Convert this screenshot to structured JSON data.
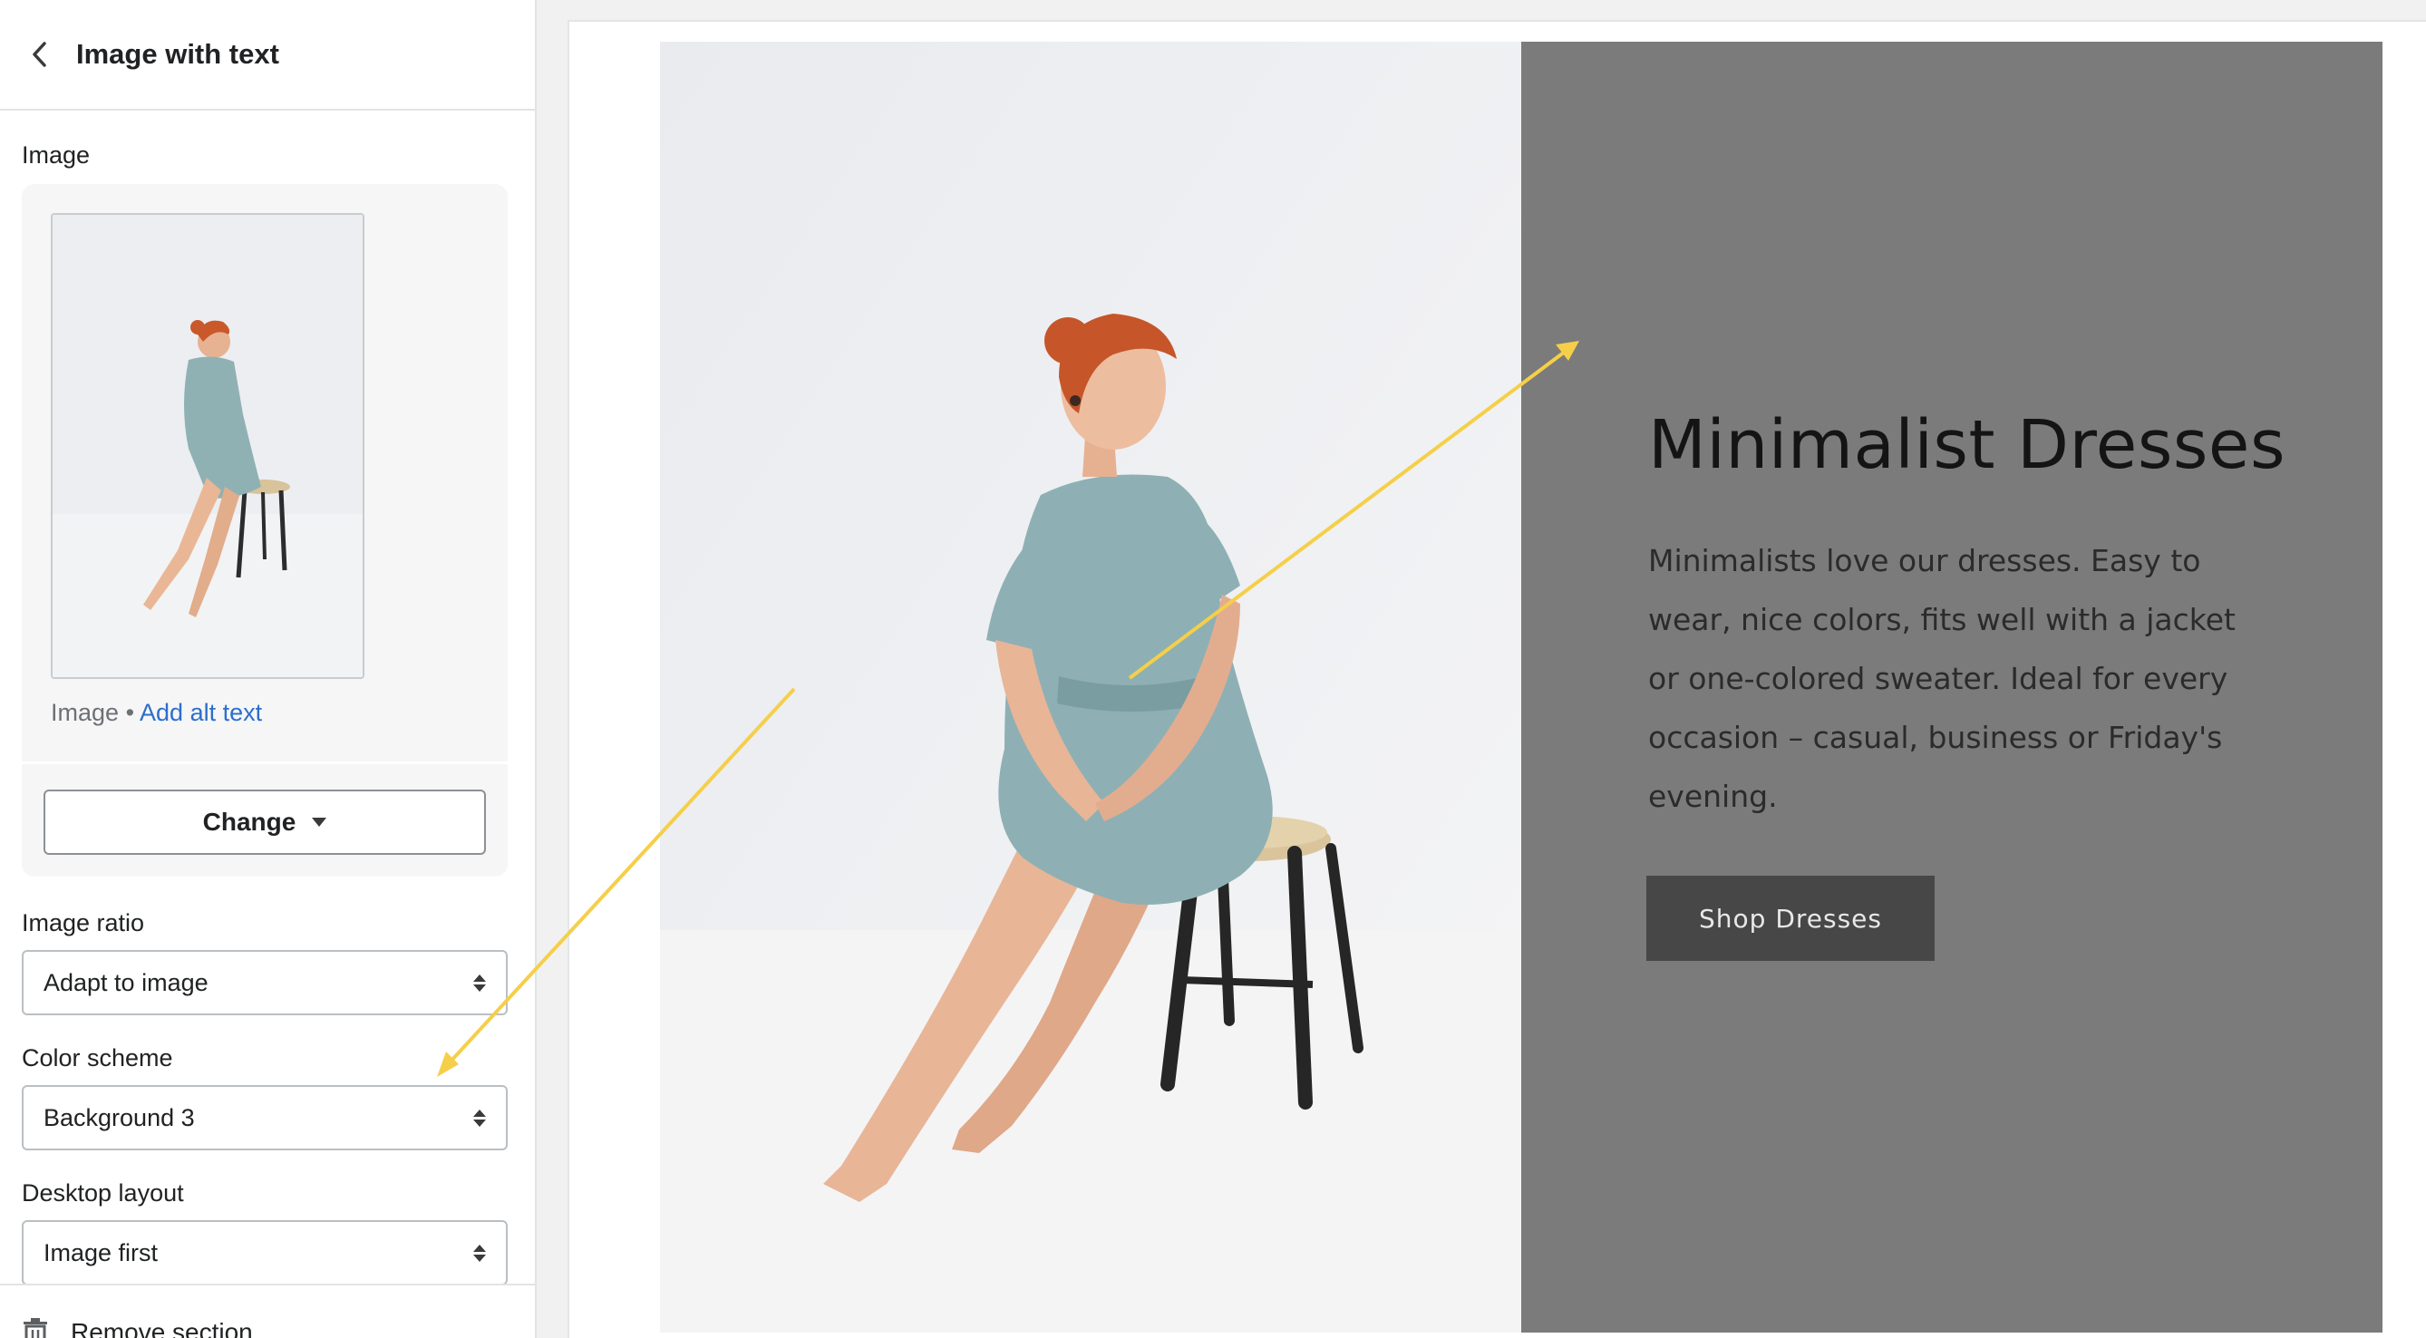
{
  "sidebar": {
    "header": {
      "title": "Image with text"
    },
    "image_label": "Image",
    "image_meta": {
      "type": "Image",
      "separator": "•",
      "alt_link": "Add alt text"
    },
    "change_button": "Change",
    "image_ratio": {
      "label": "Image ratio",
      "value": "Adapt to image"
    },
    "color_scheme": {
      "label": "Color scheme",
      "value": "Background 3"
    },
    "desktop_layout": {
      "label": "Desktop layout",
      "value": "Image first"
    },
    "remove_section": "Remove section"
  },
  "preview": {
    "heading": "Minimalist Dresses",
    "body": "Minimalists love our dresses. Easy to wear, nice colors, fits well with a jacket or one-colored sweater. Ideal for every occasion – casual, business or Friday's evening.",
    "button": "Shop Dresses",
    "panel_color": "#7b7b7b"
  },
  "annotation": {
    "arrow_color": "#f5cf49"
  }
}
